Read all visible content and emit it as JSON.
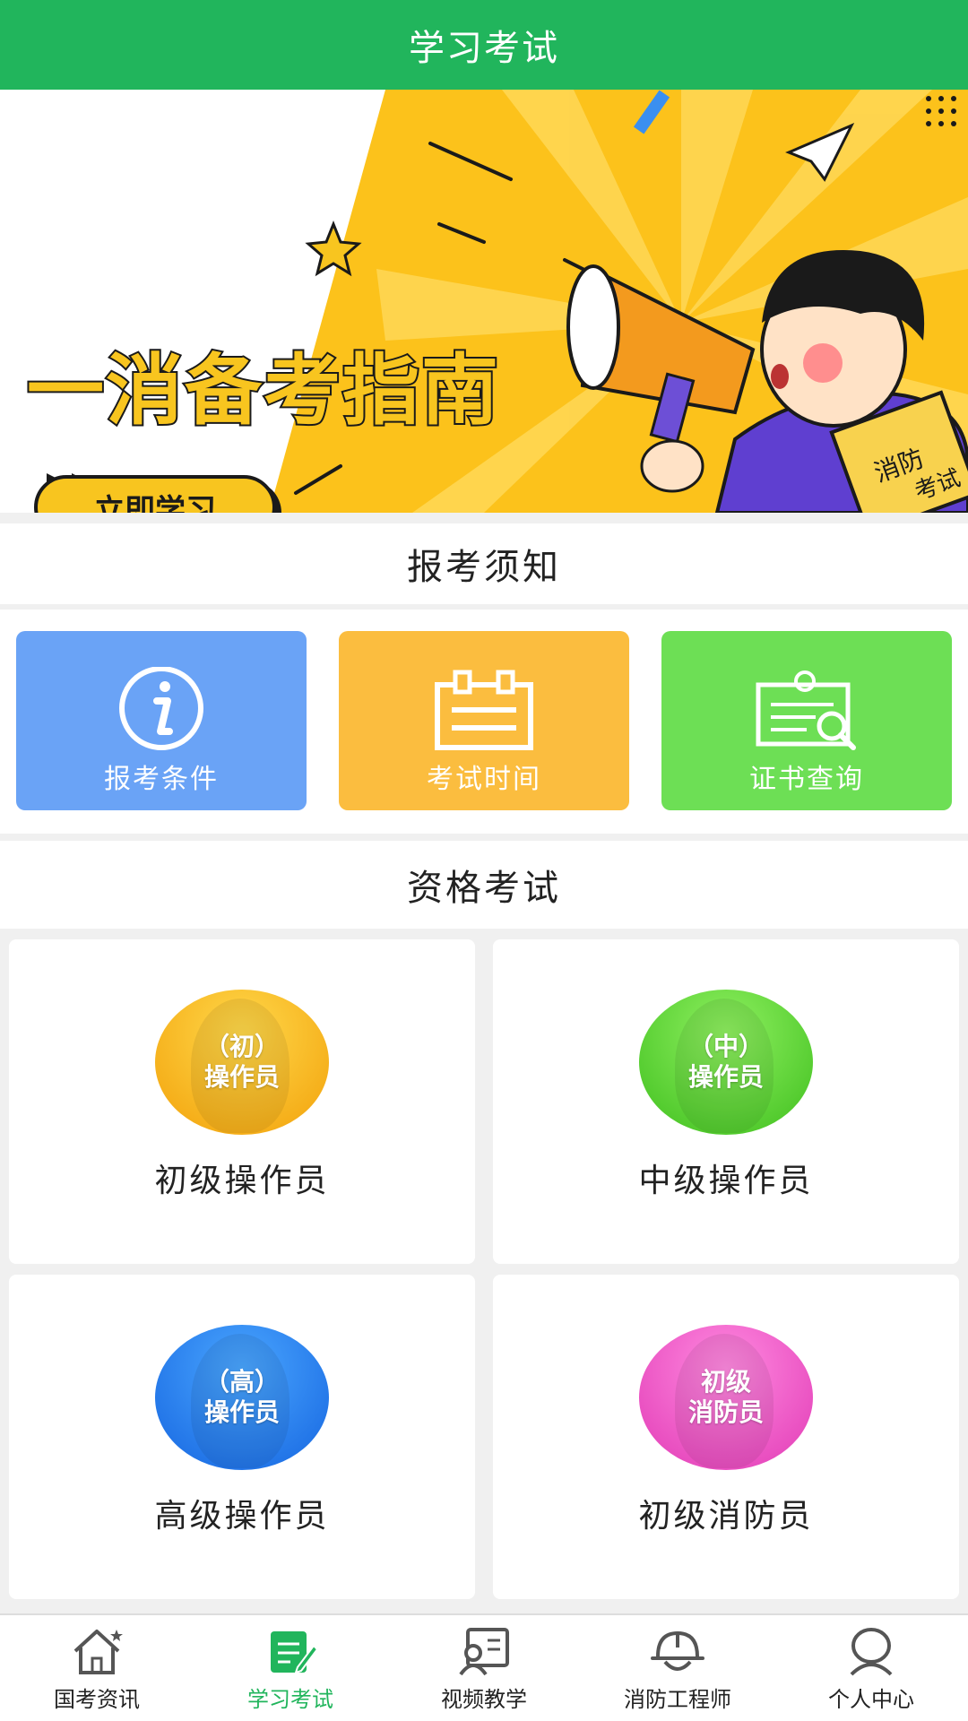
{
  "header": {
    "title": "学习考试"
  },
  "banner": {
    "headline": "一消备考指南",
    "cta_label": "立即学习",
    "book_text": "消防考试",
    "dots": 3,
    "active_dot": 0
  },
  "notice": {
    "title": "报考须知",
    "items": [
      {
        "label": "报考条件",
        "icon": "info-icon",
        "color": "#6aa3f6"
      },
      {
        "label": "考试时间",
        "icon": "calendar-icon",
        "color": "#fbbd3f"
      },
      {
        "label": "证书查询",
        "icon": "certificate-search-icon",
        "color": "#6ddf55"
      }
    ]
  },
  "exams": {
    "title": "资格考试",
    "items": [
      {
        "badge_line1": "（初）",
        "badge_line2": "操作员",
        "label": "初级操作员"
      },
      {
        "badge_line1": "（中）",
        "badge_line2": "操作员",
        "label": "中级操作员"
      },
      {
        "badge_line1": "（高）",
        "badge_line2": "操作员",
        "label": "高级操作员"
      },
      {
        "badge_line1": "初级",
        "badge_line2": "消防员",
        "label": "初级消防员"
      }
    ]
  },
  "bottom_nav": {
    "items": [
      {
        "label": "国考资讯",
        "icon": "home-icon"
      },
      {
        "label": "学习考试",
        "icon": "study-icon",
        "active": true
      },
      {
        "label": "视频教学",
        "icon": "video-teaching-icon"
      },
      {
        "label": "消防工程师",
        "icon": "helmet-icon"
      },
      {
        "label": "个人中心",
        "icon": "person-icon"
      }
    ]
  },
  "colors": {
    "brand_green": "#21b55c",
    "banner_yellow": "#f8c51f"
  }
}
